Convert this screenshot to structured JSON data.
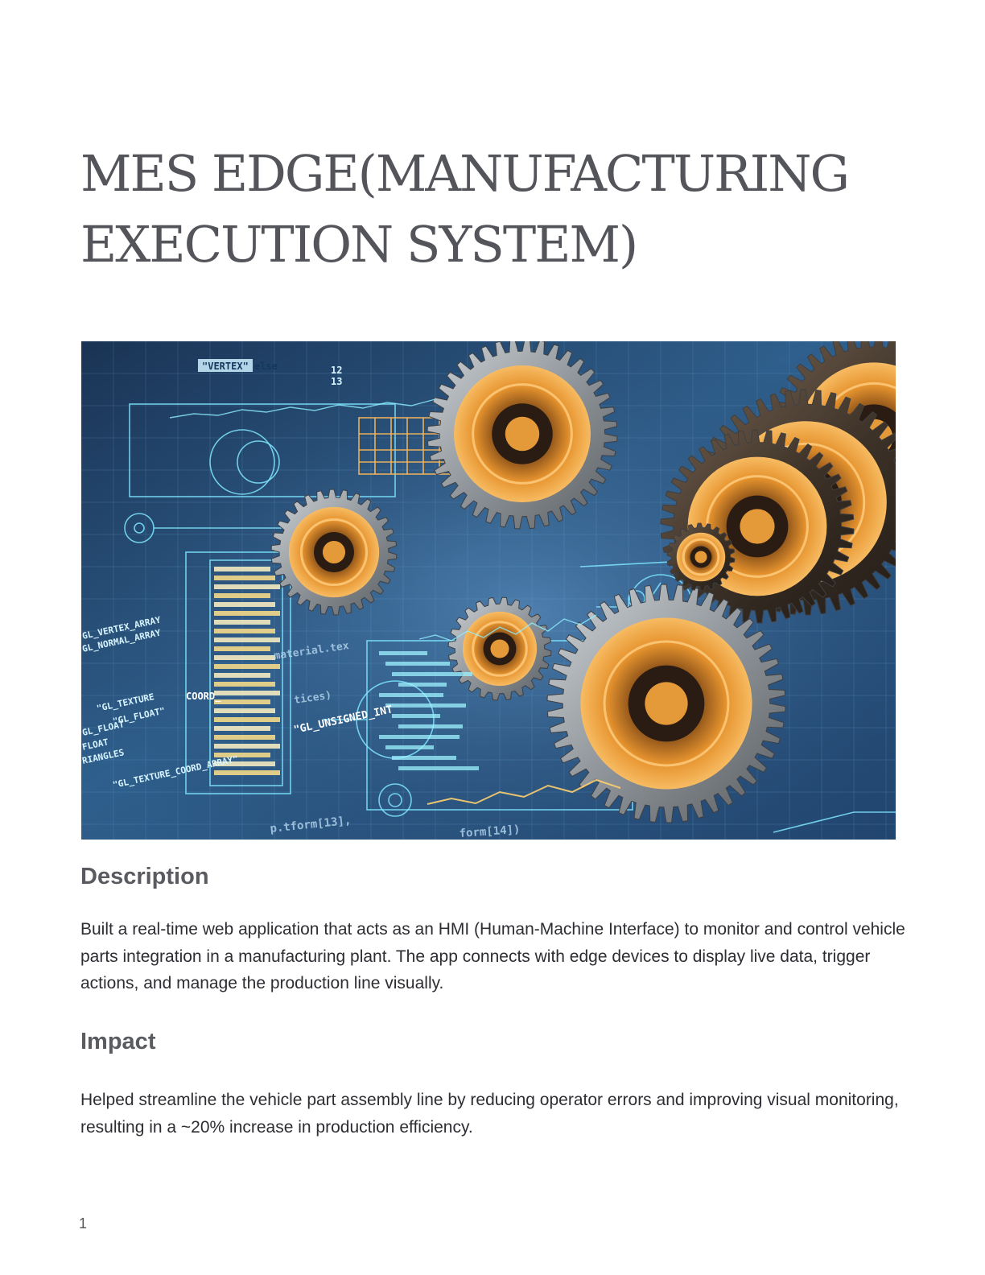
{
  "document": {
    "title": "MES EDGE(MANUFACTURING EXECUTION SYSTEM)",
    "hero_image": {
      "overlay_texts": [
        "\"VERTEX\" else",
        "COORD_",
        "\"GL_UNSIGNED_INT",
        "GL_VERTEX_ARRAY",
        "GL_NORMAL_ARRAY",
        "\"GL_TEXTURE",
        "\"GL_FLOAT\"",
        "GL_FLOAT",
        "FLOAT",
        "RIANGLES",
        "\"GL_TEXTURE_COORD_ARRAY\"",
        "material.tex",
        "tices)",
        "p.tform[13],",
        "form[14])",
        "12",
        "13"
      ]
    },
    "sections": [
      {
        "heading": "Description",
        "text": "Built a real-time web application that acts as an HMI (Human-Machine Interface) to monitor and control vehicle parts integration in a manufacturing plant. The app connects with edge devices to display live data, trigger actions, and manage the production line visually."
      },
      {
        "heading": "Impact",
        "text": "Helped streamline the vehicle part assembly line by reducing operator errors and improving visual monitoring, resulting in a ~20% increase in production efficiency."
      }
    ],
    "page_number": "1"
  }
}
